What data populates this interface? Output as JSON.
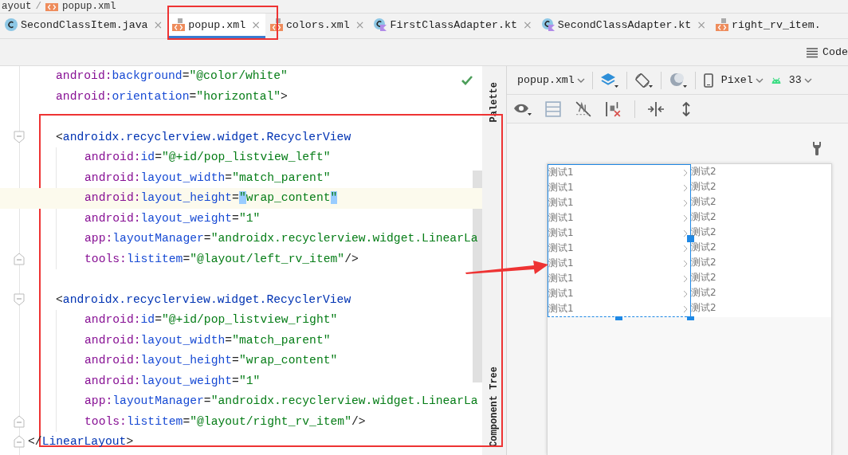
{
  "breadcrumb": {
    "items": [
      "ayout",
      "popup.xml"
    ],
    "separator": "/"
  },
  "tabs": [
    {
      "label": "SecondClassItem.java",
      "kind": "java",
      "close": "×",
      "selected": false
    },
    {
      "label": "popup.xml",
      "kind": "xml",
      "close": "×",
      "selected": true
    },
    {
      "label": "colors.xml",
      "kind": "xml",
      "close": "×",
      "selected": false
    },
    {
      "label": "FirstClassAdapter.kt",
      "kind": "kotlin",
      "close": "×",
      "selected": false
    },
    {
      "label": "SecondClassAdapter.kt",
      "kind": "kotlin",
      "close": "×",
      "selected": false
    },
    {
      "label": "right_rv_item.",
      "kind": "xml",
      "selected": false
    }
  ],
  "view_mode": {
    "label": "Code"
  },
  "editor": {
    "lines": [
      {
        "kind": "code",
        "tokens": [
          {
            "kind": "ns",
            "t": "android:"
          },
          {
            "kind": "attr",
            "t": "background"
          },
          {
            "kind": "punct",
            "t": "="
          },
          {
            "kind": "value",
            "t": "\"@color/white\""
          }
        ]
      },
      {
        "kind": "code",
        "tokens": [
          {
            "kind": "ns",
            "t": "android:"
          },
          {
            "kind": "attr",
            "t": "orientation"
          },
          {
            "kind": "punct",
            "t": "="
          },
          {
            "kind": "value",
            "t": "\"horizontal\""
          },
          {
            "kind": "punct",
            "t": ">"
          }
        ]
      },
      {
        "kind": "blank"
      },
      {
        "kind": "code",
        "tokens": [
          {
            "kind": "punct",
            "t": "<"
          },
          {
            "kind": "tag",
            "t": "androidx.recyclerview.widget.RecyclerView"
          }
        ],
        "children": [
          {
            "kind": "code",
            "tokens": [
              {
                "kind": "ns",
                "t": "android:"
              },
              {
                "kind": "attr",
                "t": "id"
              },
              {
                "kind": "punct",
                "t": "="
              },
              {
                "kind": "value",
                "t": "\"@+id/pop_listview_left\""
              }
            ]
          },
          {
            "kind": "code",
            "tokens": [
              {
                "kind": "ns",
                "t": "android:"
              },
              {
                "kind": "attr",
                "t": "layout_width"
              },
              {
                "kind": "punct",
                "t": "="
              },
              {
                "kind": "value",
                "t": "\"match_parent\""
              }
            ]
          },
          {
            "kind": "code",
            "tokens": [
              {
                "kind": "ns",
                "t": "android:"
              },
              {
                "kind": "attr",
                "t": "layout_height"
              },
              {
                "kind": "punct",
                "t": "="
              },
              {
                "kind": "match",
                "t": "\""
              },
              {
                "kind": "value",
                "t": "wrap_content"
              },
              {
                "kind": "match",
                "t": "\""
              }
            ],
            "current": true
          },
          {
            "kind": "code",
            "tokens": [
              {
                "kind": "ns",
                "t": "android:"
              },
              {
                "kind": "attr",
                "t": "layout_weight"
              },
              {
                "kind": "punct",
                "t": "="
              },
              {
                "kind": "value",
                "t": "\"1\""
              }
            ]
          },
          {
            "kind": "code",
            "tokens": [
              {
                "kind": "ns",
                "t": "app:"
              },
              {
                "kind": "attr",
                "t": "layoutManager"
              },
              {
                "kind": "punct",
                "t": "="
              },
              {
                "kind": "value",
                "t": "\"androidx.recyclerview.widget.LinearLa"
              }
            ]
          },
          {
            "kind": "code",
            "tokens": [
              {
                "kind": "ns",
                "t": "tools:"
              },
              {
                "kind": "attr",
                "t": "listitem"
              },
              {
                "kind": "punct",
                "t": "="
              },
              {
                "kind": "value",
                "t": "\"@layout/left_rv_item\""
              },
              {
                "kind": "punct",
                "t": "/>"
              }
            ]
          }
        ]
      },
      {
        "kind": "blank"
      },
      {
        "kind": "code",
        "tokens": [
          {
            "kind": "punct",
            "t": "<"
          },
          {
            "kind": "tag",
            "t": "androidx.recyclerview.widget.RecyclerView"
          }
        ],
        "children": [
          {
            "kind": "code",
            "tokens": [
              {
                "kind": "ns",
                "t": "android:"
              },
              {
                "kind": "attr",
                "t": "id"
              },
              {
                "kind": "punct",
                "t": "="
              },
              {
                "kind": "value",
                "t": "\"@+id/pop_listview_right\""
              }
            ]
          },
          {
            "kind": "code",
            "tokens": [
              {
                "kind": "ns",
                "t": "android:"
              },
              {
                "kind": "attr",
                "t": "layout_width"
              },
              {
                "kind": "punct",
                "t": "="
              },
              {
                "kind": "value",
                "t": "\"match_parent\""
              }
            ]
          },
          {
            "kind": "code",
            "tokens": [
              {
                "kind": "ns",
                "t": "android:"
              },
              {
                "kind": "attr",
                "t": "layout_height"
              },
              {
                "kind": "punct",
                "t": "="
              },
              {
                "kind": "value",
                "t": "\"wrap_content\""
              }
            ]
          },
          {
            "kind": "code",
            "tokens": [
              {
                "kind": "ns",
                "t": "android:"
              },
              {
                "kind": "attr",
                "t": "layout_weight"
              },
              {
                "kind": "punct",
                "t": "="
              },
              {
                "kind": "value",
                "t": "\"1\""
              }
            ]
          },
          {
            "kind": "code",
            "tokens": [
              {
                "kind": "ns",
                "t": "app:"
              },
              {
                "kind": "attr",
                "t": "layoutManager"
              },
              {
                "kind": "punct",
                "t": "="
              },
              {
                "kind": "value",
                "t": "\"androidx.recyclerview.widget.LinearLa"
              }
            ]
          },
          {
            "kind": "code",
            "tokens": [
              {
                "kind": "ns",
                "t": "tools:"
              },
              {
                "kind": "attr",
                "t": "listitem"
              },
              {
                "kind": "punct",
                "t": "="
              },
              {
                "kind": "value",
                "t": "\"@layout/right_rv_item\""
              },
              {
                "kind": "punct",
                "t": "/>"
              }
            ]
          }
        ]
      }
    ],
    "closing_line": [
      {
        "kind": "punct",
        "t": "</"
      },
      {
        "kind": "tag",
        "t": "LinearLayout"
      },
      {
        "kind": "punct",
        "t": ">"
      }
    ]
  },
  "side_tabs": [
    {
      "label": "Palette"
    },
    {
      "label": "Component Tree"
    }
  ],
  "design_toolbar": {
    "file": "popup.xml",
    "device": "Pixel",
    "api": "33"
  },
  "preview": {
    "lists": [
      {
        "selected": true,
        "chevrons": true,
        "items": [
          "测试1",
          "测试1",
          "测试1",
          "测试1",
          "测试1",
          "测试1",
          "测试1",
          "测试1",
          "测试1",
          "测试1"
        ]
      },
      {
        "selected": false,
        "chevrons": false,
        "items": [
          "测试2",
          "测试2",
          "测试2",
          "测试2",
          "测试2",
          "测试2",
          "测试2",
          "测试2",
          "测试2",
          "测试2"
        ]
      }
    ]
  }
}
